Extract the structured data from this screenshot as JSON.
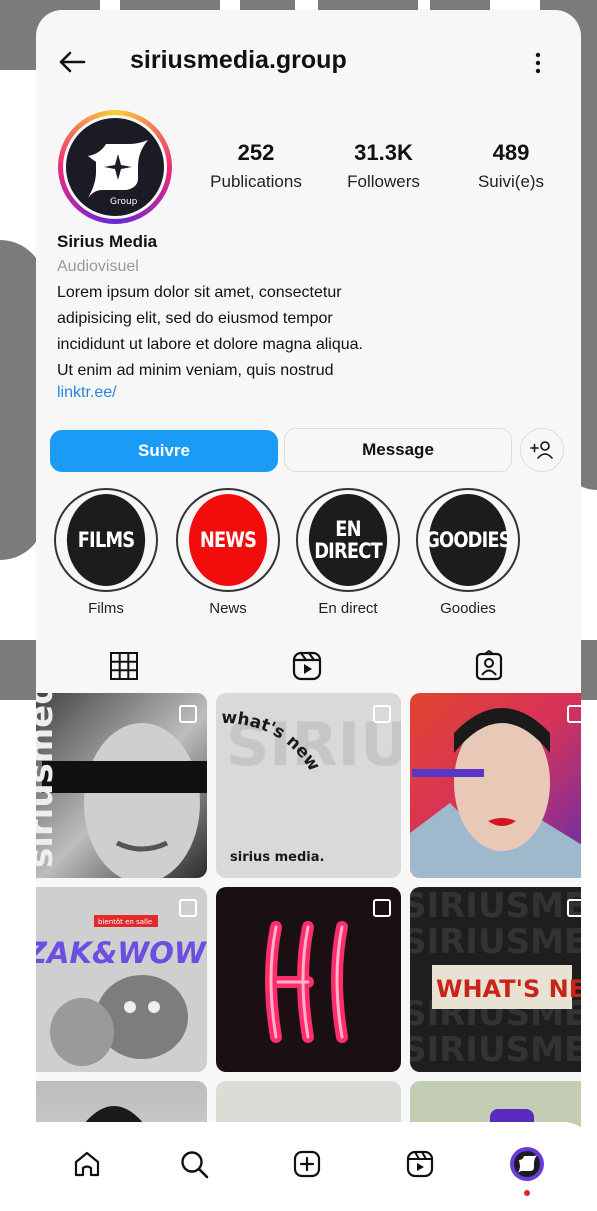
{
  "profile": {
    "username": "siriusmedia.group",
    "avatar_text": "Group",
    "stats": [
      {
        "value": "252",
        "label": "Publications"
      },
      {
        "value": "31.3K",
        "label": "Followers"
      },
      {
        "value": "489",
        "label": "Suivi(e)s"
      }
    ],
    "name": "Sirius Media",
    "category": "Audiovisuel",
    "bio_lines": [
      "Lorem ipsum dolor sit amet, consectetur",
      "adipisicing elit, sed do eiusmod tempor",
      "incididunt ut labore et dolore magna aliqua.",
      "Ut enim ad minim veniam, quis nostrud"
    ],
    "link": "linktr.ee/"
  },
  "actions": {
    "follow_label": "Suivre",
    "message_label": "Message",
    "add_icon": "add-person-icon"
  },
  "highlights": [
    {
      "cover_lines": [
        "FILMS"
      ],
      "label": "Films",
      "color": "#1c1c1c"
    },
    {
      "cover_lines": [
        "NEWS"
      ],
      "label": "News",
      "color": "#f20d0d"
    },
    {
      "cover_lines": [
        "EN",
        "DIRECT"
      ],
      "label": "En direct",
      "color": "#1c1c1c"
    },
    {
      "cover_lines": [
        "GOODIES"
      ],
      "label": "Goodies",
      "color": "#1c1c1c"
    }
  ],
  "tabs": [
    "grid-icon",
    "reels-icon",
    "tagged-icon"
  ],
  "posts": [
    {
      "text": "siriusmedia",
      "theme": "bw-face"
    },
    {
      "text": "SIRIUS",
      "sub": "what's new",
      "brand": "sirius media.",
      "theme": "grey-typo"
    },
    {
      "theme": "color-face"
    },
    {
      "text": "ZAK&WOWO",
      "badge_text": "bientôt en salle",
      "theme": "cartoon"
    },
    {
      "text": "HI",
      "theme": "neon"
    },
    {
      "text": "WHAT'S NEW",
      "bg_text": "SIRIUSMEDIA",
      "theme": "collage"
    },
    {
      "theme": "partial-1"
    },
    {
      "theme": "partial-2"
    },
    {
      "theme": "partial-3"
    }
  ],
  "navbar": [
    "home-icon",
    "search-icon",
    "create-icon",
    "reels-icon",
    "profile-avatar-icon"
  ],
  "colors": {
    "accent": "#1a9bf5",
    "link": "#2a86d8",
    "news": "#f20d0d",
    "nav_dot": "#e0242f"
  }
}
